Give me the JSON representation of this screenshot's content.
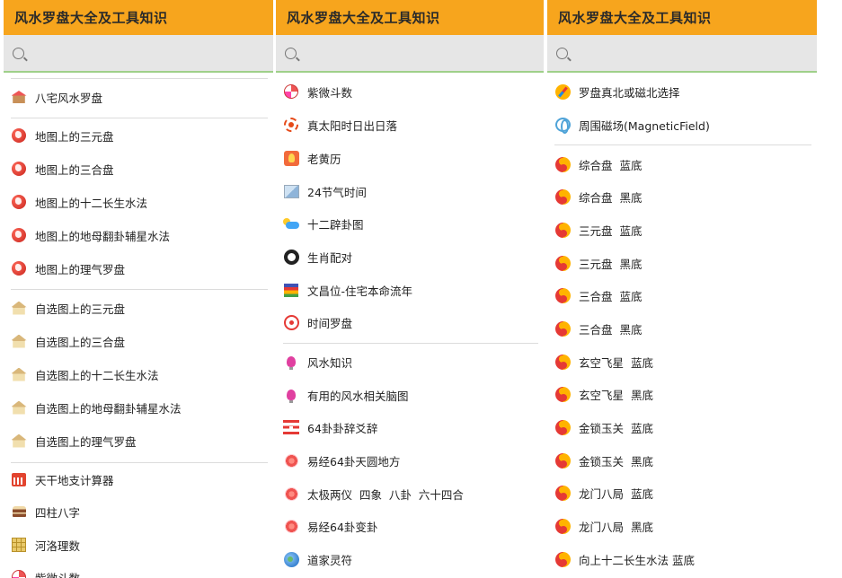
{
  "app_title": "风水罗盘大全及工具知识",
  "panels": [
    {
      "items": [
        {
          "label": "八宅风水罗盘",
          "icon": "house-icon"
        },
        {
          "label": "地图上的三元盘",
          "icon": "globe-icon"
        },
        {
          "label": "地图上的三合盘",
          "icon": "globe-icon"
        },
        {
          "label": "地图上的十二长生水法",
          "icon": "globe-icon"
        },
        {
          "label": "地图上的地母翻卦辅星水法",
          "icon": "globe-icon"
        },
        {
          "label": "地图上的理气罗盘",
          "icon": "globe-icon"
        },
        {
          "label": "自选图上的三元盘",
          "icon": "temple-icon"
        },
        {
          "label": "自选图上的三合盘",
          "icon": "temple-icon"
        },
        {
          "label": "自选图上的十二长生水法",
          "icon": "temple-icon"
        },
        {
          "label": "自选图上的地母翻卦辅星水法",
          "icon": "temple-icon"
        },
        {
          "label": "自选图上的理气罗盘",
          "icon": "temple-icon"
        },
        {
          "label": "天干地支计算器",
          "icon": "calendar-icon"
        },
        {
          "label": "四柱八字",
          "icon": "cake-icon"
        },
        {
          "label": "河洛理数",
          "icon": "grid-icon"
        },
        {
          "label": "紫微斗数",
          "icon": "ziwei-icon"
        }
      ]
    },
    {
      "items": [
        {
          "label": "紫微斗数",
          "icon": "ziwei-icon"
        },
        {
          "label": "真太阳时日出日落",
          "icon": "sun-icon"
        },
        {
          "label": "老黄历",
          "icon": "almanac-icon"
        },
        {
          "label": "24节气时间",
          "icon": "seasons-icon"
        },
        {
          "label": "十二辟卦图",
          "icon": "weather-icon"
        },
        {
          "label": "生肖配对",
          "icon": "ring-icon"
        },
        {
          "label": "文昌位-住宅本命流年",
          "icon": "books-icon"
        },
        {
          "label": "时间罗盘",
          "icon": "target-icon"
        },
        {
          "label": "风水知识",
          "icon": "bulb-icon"
        },
        {
          "label": "有用的风水相关脑图",
          "icon": "bulb-icon"
        },
        {
          "label": "64卦卦辞爻辞",
          "icon": "hexagram-icon"
        },
        {
          "label": "易经64卦天圆地方",
          "icon": "flower-icon"
        },
        {
          "label": "太极两仪  四象  八卦  六十四合",
          "icon": "flower-icon"
        },
        {
          "label": "易经64卦变卦",
          "icon": "flower-icon"
        },
        {
          "label": "道家灵符",
          "icon": "earth-icon"
        }
      ]
    },
    {
      "items": [
        {
          "label": "罗盘真北或磁北选择",
          "icon": "compass-icon"
        },
        {
          "label": "周围磁场(MagneticField)",
          "icon": "magnet-icon"
        },
        {
          "label": "综合盘  蓝底",
          "icon": "taiji-icon"
        },
        {
          "label": "综合盘  黑底",
          "icon": "taiji-icon"
        },
        {
          "label": "三元盘  蓝底",
          "icon": "taiji-icon"
        },
        {
          "label": "三元盘  黑底",
          "icon": "taiji-icon"
        },
        {
          "label": "三合盘  蓝底",
          "icon": "taiji-icon"
        },
        {
          "label": "三合盘  黑底",
          "icon": "taiji-icon"
        },
        {
          "label": "玄空飞星  蓝底",
          "icon": "taiji-icon"
        },
        {
          "label": "玄空飞星  黑底",
          "icon": "taiji-icon"
        },
        {
          "label": "金锁玉关  蓝底",
          "icon": "taiji-icon"
        },
        {
          "label": "金锁玉关  黑底",
          "icon": "taiji-icon"
        },
        {
          "label": "龙门八局  蓝底",
          "icon": "taiji-icon"
        },
        {
          "label": "龙门八局  黑底",
          "icon": "taiji-icon"
        },
        {
          "label": "向上十二长生水法 蓝底",
          "icon": "taiji-icon"
        }
      ]
    }
  ]
}
